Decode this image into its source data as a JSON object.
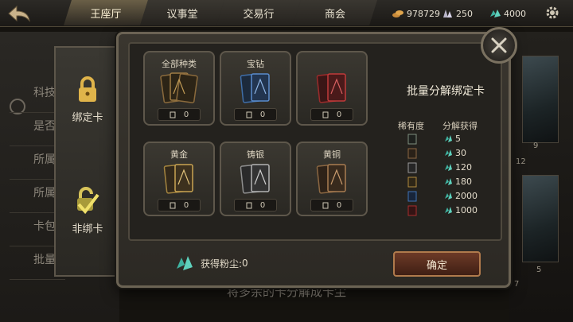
{
  "topbar": {
    "tabs": [
      {
        "label": "王座厅",
        "active": true
      },
      {
        "label": "议事堂",
        "active": false
      },
      {
        "label": "交易行",
        "active": false
      },
      {
        "label": "商会",
        "active": false
      }
    ],
    "resources": [
      {
        "icon": "gold-coin-icon",
        "value": "978729"
      },
      {
        "icon": "crystal-icon",
        "value": "250"
      },
      {
        "icon": "card-dust-icon",
        "value": "4000"
      }
    ]
  },
  "background": {
    "left_list": [
      "科技",
      "是否",
      "所属",
      "所属",
      "卡包",
      "批量"
    ],
    "card_numbers": [
      "9",
      "12",
      "5",
      "7"
    ],
    "subtitle": "将多余的卡分解成卡尘"
  },
  "side_tabs": [
    {
      "label": "绑定卡",
      "icon": "lock-icon",
      "active": true
    },
    {
      "label": "非绑卡",
      "icon": "unlocked-check-icon",
      "active": false
    }
  ],
  "slots": [
    {
      "name": "全部种类",
      "count": "0",
      "color": "#8a6a3c"
    },
    {
      "name": "宝钻",
      "count": "0",
      "color": "#3f6ea8"
    },
    {
      "name": "",
      "count": "0",
      "color": "#9b2b2b"
    },
    {
      "name": "黄金",
      "count": "0",
      "color": "#a5853f"
    },
    {
      "name": "铸银",
      "count": "0",
      "color": "#8f8f8f"
    },
    {
      "name": "黄铜",
      "count": "0",
      "color": "#8b6742"
    }
  ],
  "info": {
    "title": "批量分解绑定卡",
    "rarity_header": "稀有度",
    "reward_header": "分解获得",
    "rows": [
      {
        "rarity_color": "#7f8f7f",
        "reward": "5"
      },
      {
        "rarity_color": "#8b6742",
        "reward": "30"
      },
      {
        "rarity_color": "#9a9a9a",
        "reward": "120"
      },
      {
        "rarity_color": "#b08a3d",
        "reward": "180"
      },
      {
        "rarity_color": "#4173b4",
        "reward": "2000"
      },
      {
        "rarity_color": "#a62d2d",
        "reward": "1000"
      }
    ]
  },
  "footer": {
    "dust_label": "获得粉尘:",
    "dust_value": "0",
    "confirm_label": "确定"
  }
}
